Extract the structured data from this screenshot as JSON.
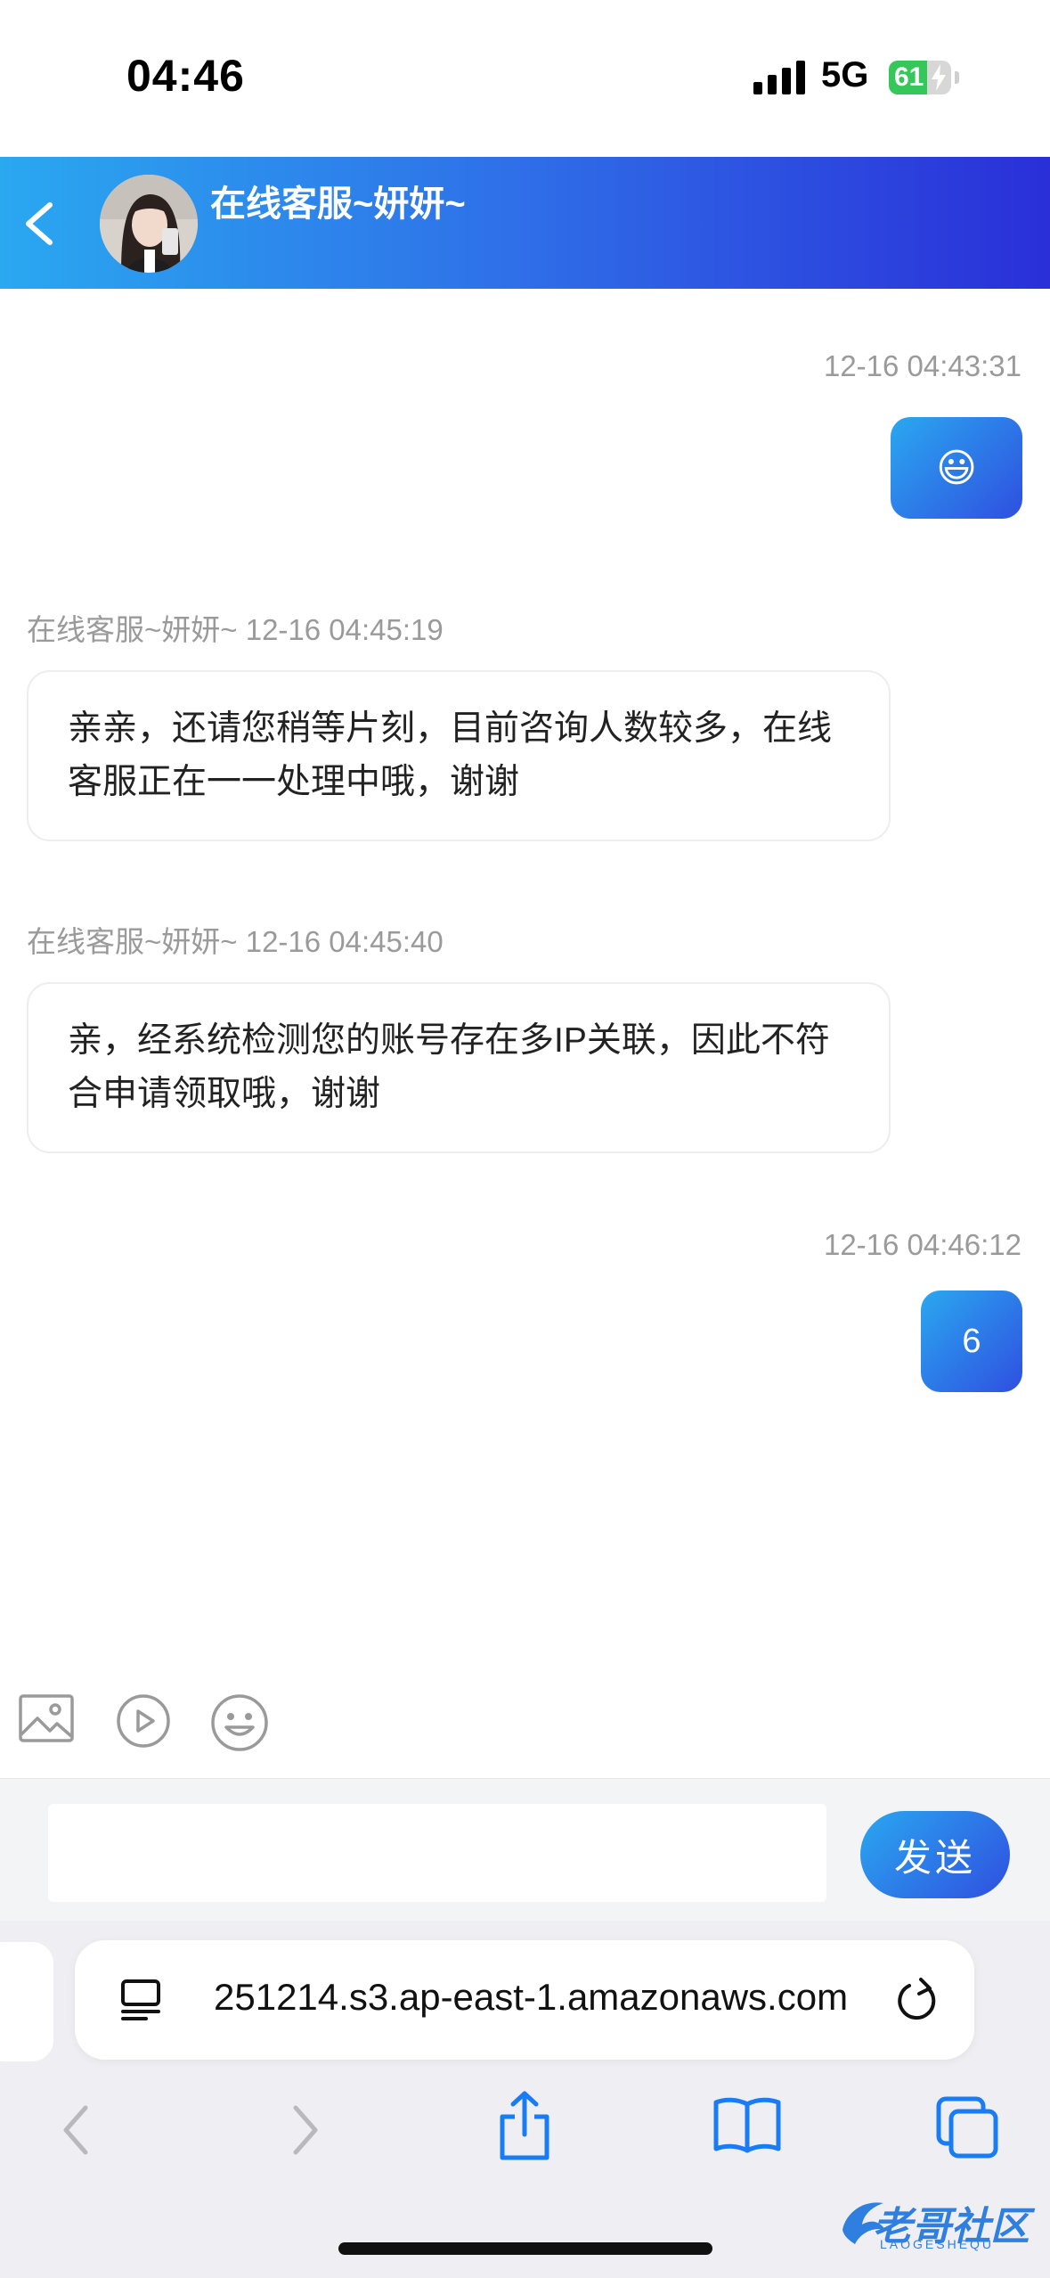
{
  "status_bar": {
    "time": "04:46",
    "network": "5G",
    "battery": "61",
    "battery_level": 0.61
  },
  "header": {
    "title": "在线客服~妍妍~"
  },
  "messages": [
    {
      "direction": "out",
      "timestamp": "12-16 04:43:31",
      "content": "😃"
    },
    {
      "direction": "in",
      "sender": "在线客服~妍妍~",
      "timestamp": "12-16 04:45:19",
      "content": "亲亲，还请您稍等片刻，目前咨询人数较多，在线客服正在一一处理中哦，谢谢"
    },
    {
      "direction": "in",
      "sender": "在线客服~妍妍~",
      "timestamp": "12-16 04:45:40",
      "content": "亲，经系统检测您的账号存在多IP关联，因此不符合申请领取哦，谢谢"
    },
    {
      "direction": "out",
      "timestamp": "12-16 04:46:12",
      "content": "6"
    }
  ],
  "toolbar": {
    "icons": [
      "image-icon",
      "video-icon",
      "emoji-icon"
    ]
  },
  "composer": {
    "value": "",
    "send_label": "发送"
  },
  "browser": {
    "url": "251214.s3.ap-east-1.amazonaws.com"
  },
  "watermark": {
    "text": "老哥社区",
    "sub": "LAOGESHEQU"
  },
  "colors": {
    "accent_start": "#2aa8f0",
    "accent_end": "#2a2fd8",
    "ios_blue": "#1a7cf5"
  }
}
